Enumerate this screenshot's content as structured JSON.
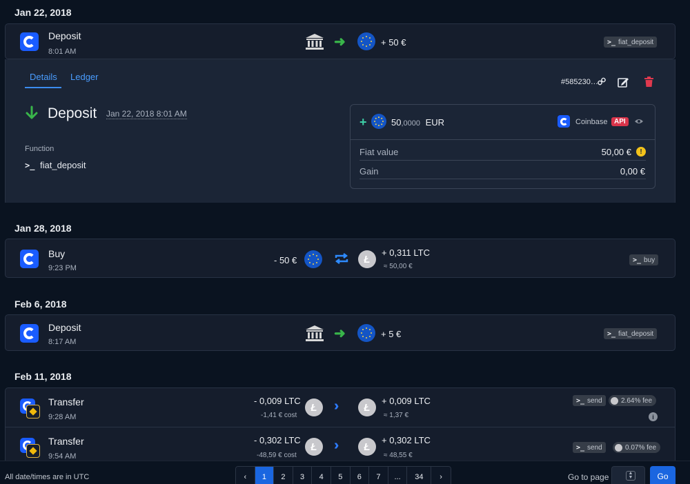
{
  "groups": [
    {
      "date": "Jan 22, 2018"
    },
    {
      "date": "Jan 28, 2018"
    },
    {
      "date": "Feb 6, 2018"
    },
    {
      "date": "Feb 11, 2018"
    }
  ],
  "tx1": {
    "title": "Deposit",
    "time": "8:01 AM",
    "amount": "+ 50 €",
    "function": "fiat_deposit"
  },
  "details": {
    "tabs": [
      "Details",
      "Ledger"
    ],
    "id": "#585230…",
    "title": "Deposit",
    "date": "Jan 22, 2018 8:01 AM",
    "function_label": "Function",
    "function_value": "fiat_deposit",
    "ledger": {
      "sign": "+",
      "amount_main": "50",
      "amount_dec": ",0000",
      "currency": "EUR",
      "source": "Coinbase",
      "api_badge": "API",
      "fiat_label": "Fiat value",
      "fiat_value": "50,00 €",
      "gain_label": "Gain",
      "gain_value": "0,00 €"
    }
  },
  "tx2": {
    "title": "Buy",
    "time": "9:23 PM",
    "out_amount": "- 50 €",
    "in_amount": "+ 0,311 LTC",
    "in_sub": "≈ 50,00 €",
    "function": "buy"
  },
  "tx3": {
    "title": "Deposit",
    "time": "8:17 AM",
    "amount": "+ 5 €",
    "function": "fiat_deposit"
  },
  "tx4": {
    "title": "Transfer",
    "time": "9:28 AM",
    "out_amount": "- 0,009 LTC",
    "out_sub": "-1,41 € cost",
    "in_amount": "+ 0,009 LTC",
    "in_sub": "≈ 1,37 €",
    "function": "send",
    "fee": "2.64% fee"
  },
  "tx5": {
    "title": "Transfer",
    "time": "9:54 AM",
    "out_amount": "- 0,302 LTC",
    "out_sub": "-48,59 € cost",
    "in_amount": "+ 0,302 LTC",
    "in_sub": "≈ 48,55 €",
    "function": "send",
    "fee": "0.07% fee"
  },
  "footer": {
    "note": "All date/times are in UTC",
    "pages": [
      "‹",
      "1",
      "2",
      "3",
      "4",
      "5",
      "6",
      "7",
      "...",
      "34",
      "›"
    ],
    "active_page": "1",
    "goto_label": "Go to page",
    "go_button": "Go"
  },
  "icons": {
    "prompt": "terminal-prompt-icon",
    "bank": "bank-icon",
    "arrow": "arrow-right-icon",
    "eur": "eur-coin-icon",
    "ltc": "ltc-coin-icon",
    "swap": "swap-icon",
    "transfer": "double-chevron-icon",
    "link": "link-icon",
    "edit": "edit-icon",
    "delete": "trash-icon",
    "eye": "eye-icon",
    "warning": "warning-icon",
    "info": "info-icon"
  },
  "colors": {
    "accent": "#1a66e0",
    "green": "#39b54a",
    "danger": "#d9344a",
    "warning": "#f2c21b"
  }
}
